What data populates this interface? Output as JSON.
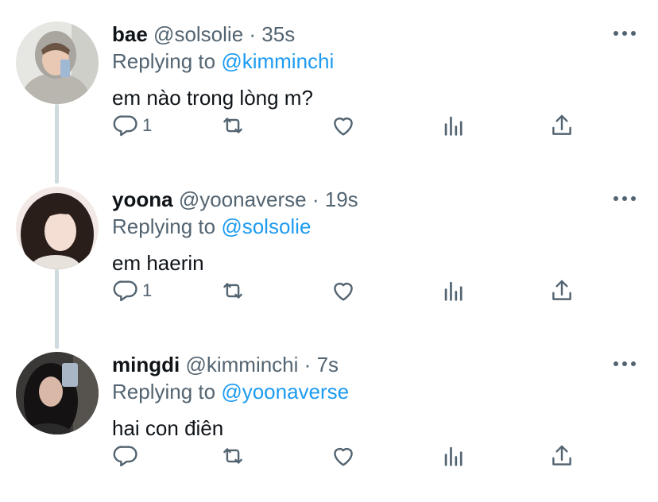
{
  "tweets": [
    {
      "name": "bae",
      "handle": "@solsolie",
      "dot": "·",
      "time": "35s",
      "replying_prefix": "Replying to",
      "replying_to": "@kimminchi",
      "text": "em nào trong lòng m?",
      "reply_count": "1"
    },
    {
      "name": "yoona",
      "handle": "@yoonaverse",
      "dot": "·",
      "time": "19s",
      "replying_prefix": "Replying to",
      "replying_to": "@solsolie",
      "text": "em haerin",
      "reply_count": "1"
    },
    {
      "name": "mingdi",
      "handle": "@kimminchi",
      "dot": "·",
      "time": "7s",
      "replying_prefix": "Replying to",
      "replying_to": "@yoonaverse",
      "text": "hai con điên",
      "reply_count": ""
    }
  ],
  "icons": {
    "reply": "reply-icon",
    "retweet": "retweet-icon",
    "like": "heart-icon",
    "views": "analytics-icon",
    "share": "share-icon",
    "more": "more-icon"
  },
  "colors": {
    "link": "#1d9bf0",
    "secondary": "#536471",
    "primary": "#0f1419",
    "thread_line": "#cfd9de"
  }
}
